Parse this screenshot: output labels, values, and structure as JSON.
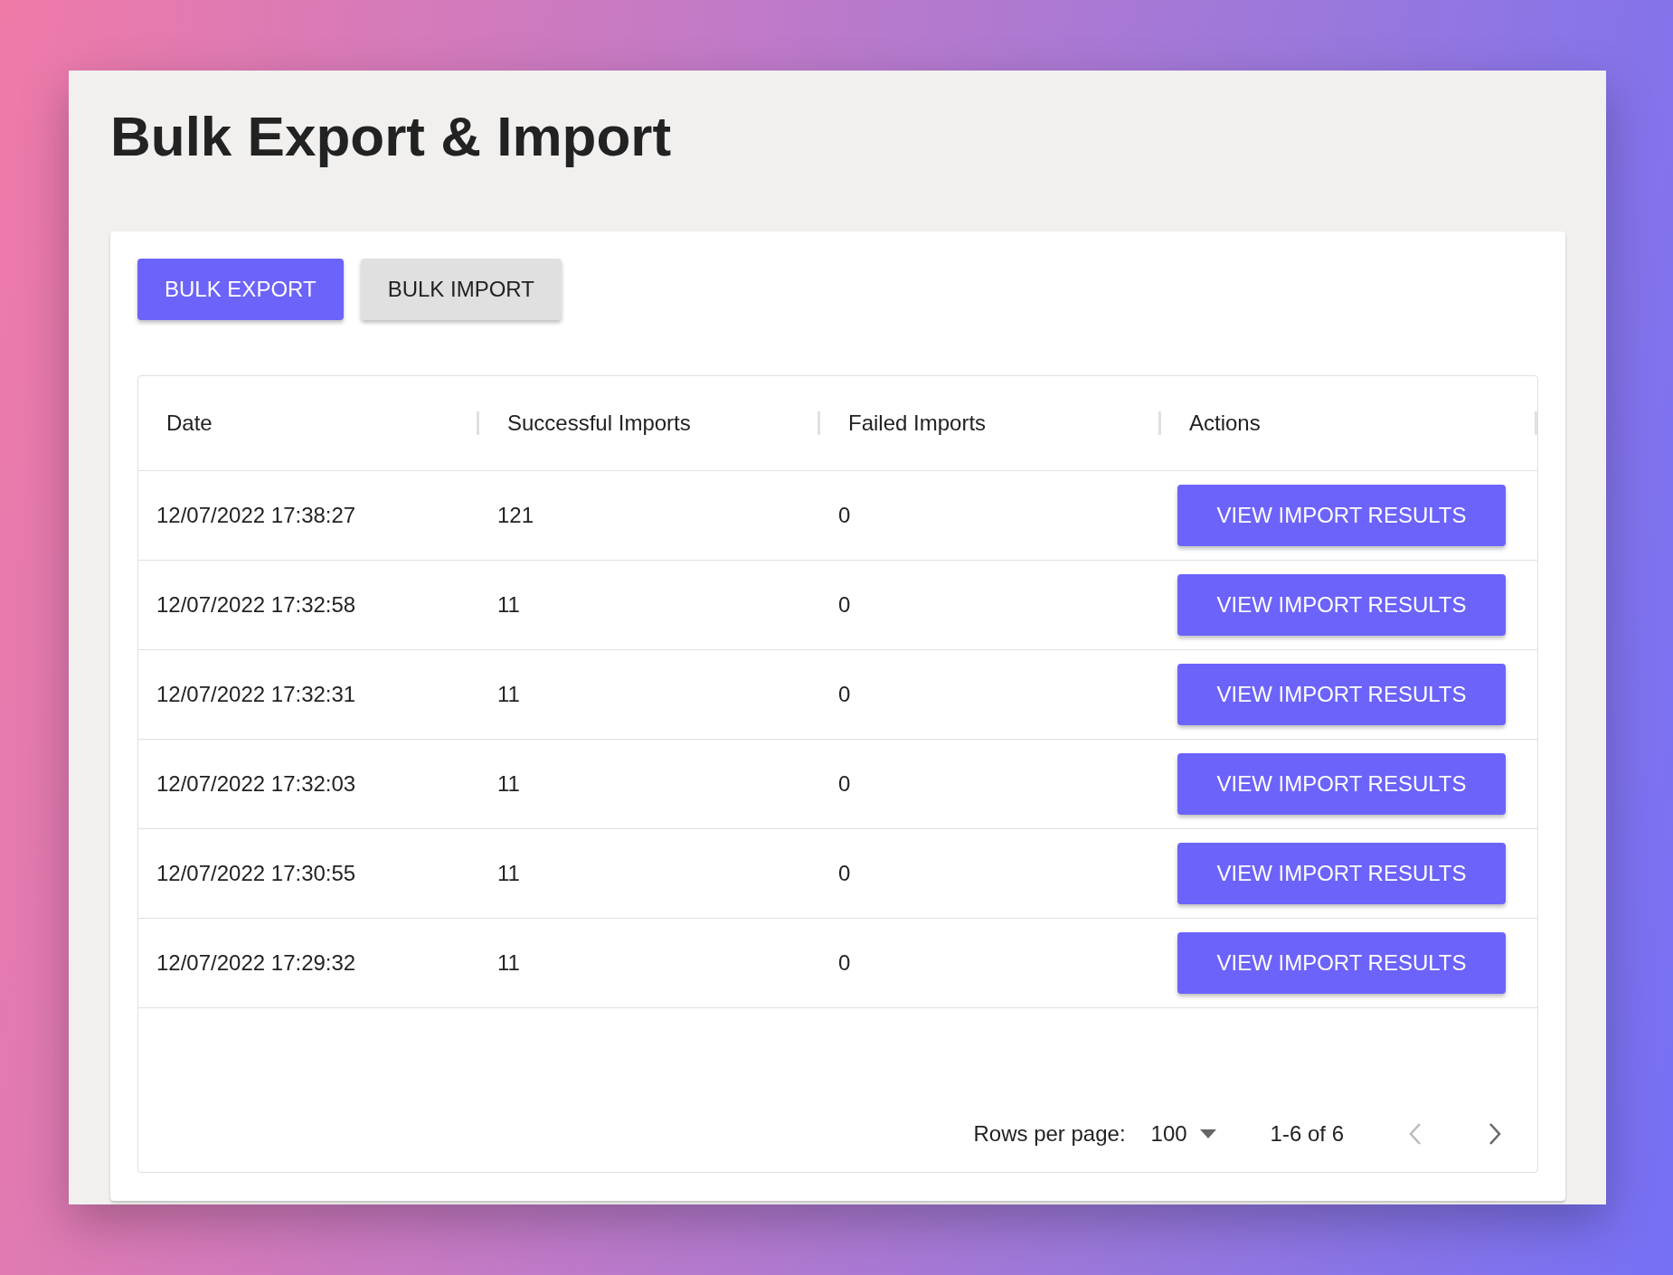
{
  "title": "Bulk Export & Import",
  "buttons": [
    {
      "label": "BULK EXPORT",
      "selected": true
    },
    {
      "label": "BULK IMPORT",
      "selected": false
    }
  ],
  "table": {
    "columns": [
      "Date",
      "Successful Imports",
      "Failed Imports",
      "Actions"
    ],
    "rows": [
      {
        "date": "12/07/2022 17:38:27",
        "successful": "121",
        "failed": "0",
        "action": "VIEW IMPORT RESULTS"
      },
      {
        "date": "12/07/2022 17:32:58",
        "successful": "11",
        "failed": "0",
        "action": "VIEW IMPORT RESULTS"
      },
      {
        "date": "12/07/2022 17:32:31",
        "successful": "11",
        "failed": "0",
        "action": "VIEW IMPORT RESULTS"
      },
      {
        "date": "12/07/2022 17:32:03",
        "successful": "11",
        "failed": "0",
        "action": "VIEW IMPORT RESULTS"
      },
      {
        "date": "12/07/2022 17:30:55",
        "successful": "11",
        "failed": "0",
        "action": "VIEW IMPORT RESULTS"
      },
      {
        "date": "12/07/2022 17:29:32",
        "successful": "11",
        "failed": "0",
        "action": "VIEW IMPORT RESULTS"
      }
    ]
  },
  "pagination": {
    "rows_per_page_label": "Rows per page:",
    "rows_per_page": "100",
    "range": "1-6 of 6",
    "previous_disabled": true,
    "next_disabled": false
  }
}
